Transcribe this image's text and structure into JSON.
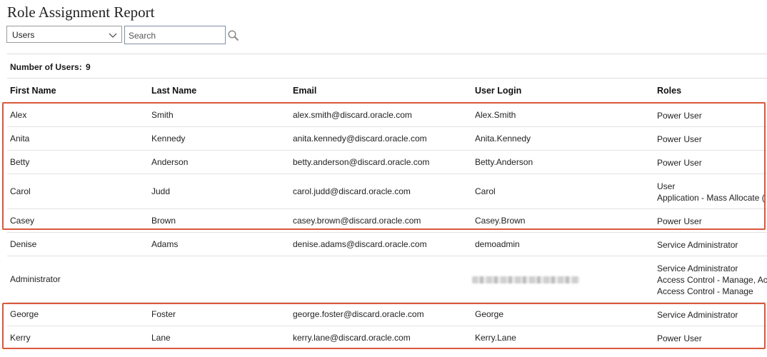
{
  "page": {
    "title": "Role Assignment Report"
  },
  "filter": {
    "selected": "Users",
    "chevron_icon": "chevron-down-icon"
  },
  "search": {
    "placeholder": "Search",
    "icon": "magnifier-icon"
  },
  "summary": {
    "label": "Number of Users:",
    "count": "9"
  },
  "columns": [
    "First Name",
    "Last Name",
    "Email",
    "User Login",
    "Roles"
  ],
  "rows": [
    {
      "first": "Alex",
      "last": "Smith",
      "email": "alex.smith@discard.oracle.com",
      "login": "Alex.Smith",
      "role": "Power User",
      "extra": []
    },
    {
      "first": "Anita",
      "last": "Kennedy",
      "email": "anita.kennedy@discard.oracle.com",
      "login": "Anita.Kennedy",
      "role": "Power User",
      "extra": []
    },
    {
      "first": "Betty",
      "last": "Anderson",
      "email": "betty.anderson@discard.oracle.com",
      "login": "Betty.Anderson",
      "role": "Power User",
      "extra": []
    },
    {
      "first": "Carol",
      "last": "Judd",
      "email": "carol.judd@discard.oracle.com",
      "login": "Carol",
      "role": "User",
      "extra": [
        "Application - Mass Allocate ("
      ]
    },
    {
      "first": "Casey",
      "last": "Brown",
      "email": "casey.brown@discard.oracle.com",
      "login": "Casey.Brown",
      "role": "Power User",
      "extra": []
    },
    {
      "first": "Denise",
      "last": "Adams",
      "email": "denise.adams@discard.oracle.com",
      "login": "demoadmin",
      "role": "Service Administrator",
      "extra": []
    },
    {
      "first": "Administrator",
      "last": "",
      "email": "",
      "login": "",
      "login_redacted": true,
      "role": "Service Administrator",
      "extra": [
        "Access Control - Manage, Ac",
        "Access Control - Manage"
      ]
    },
    {
      "first": "George",
      "last": "Foster",
      "email": "george.foster@discard.oracle.com",
      "login": "George",
      "role": "Service Administrator",
      "extra": []
    },
    {
      "first": "Kerry",
      "last": "Lane",
      "email": "kerry.lane@discard.oracle.com",
      "login": "Kerry.Lane",
      "role": "Power User",
      "extra": []
    }
  ],
  "colors": {
    "highlight": "#d9573a",
    "divider": "#e2e2e2"
  }
}
